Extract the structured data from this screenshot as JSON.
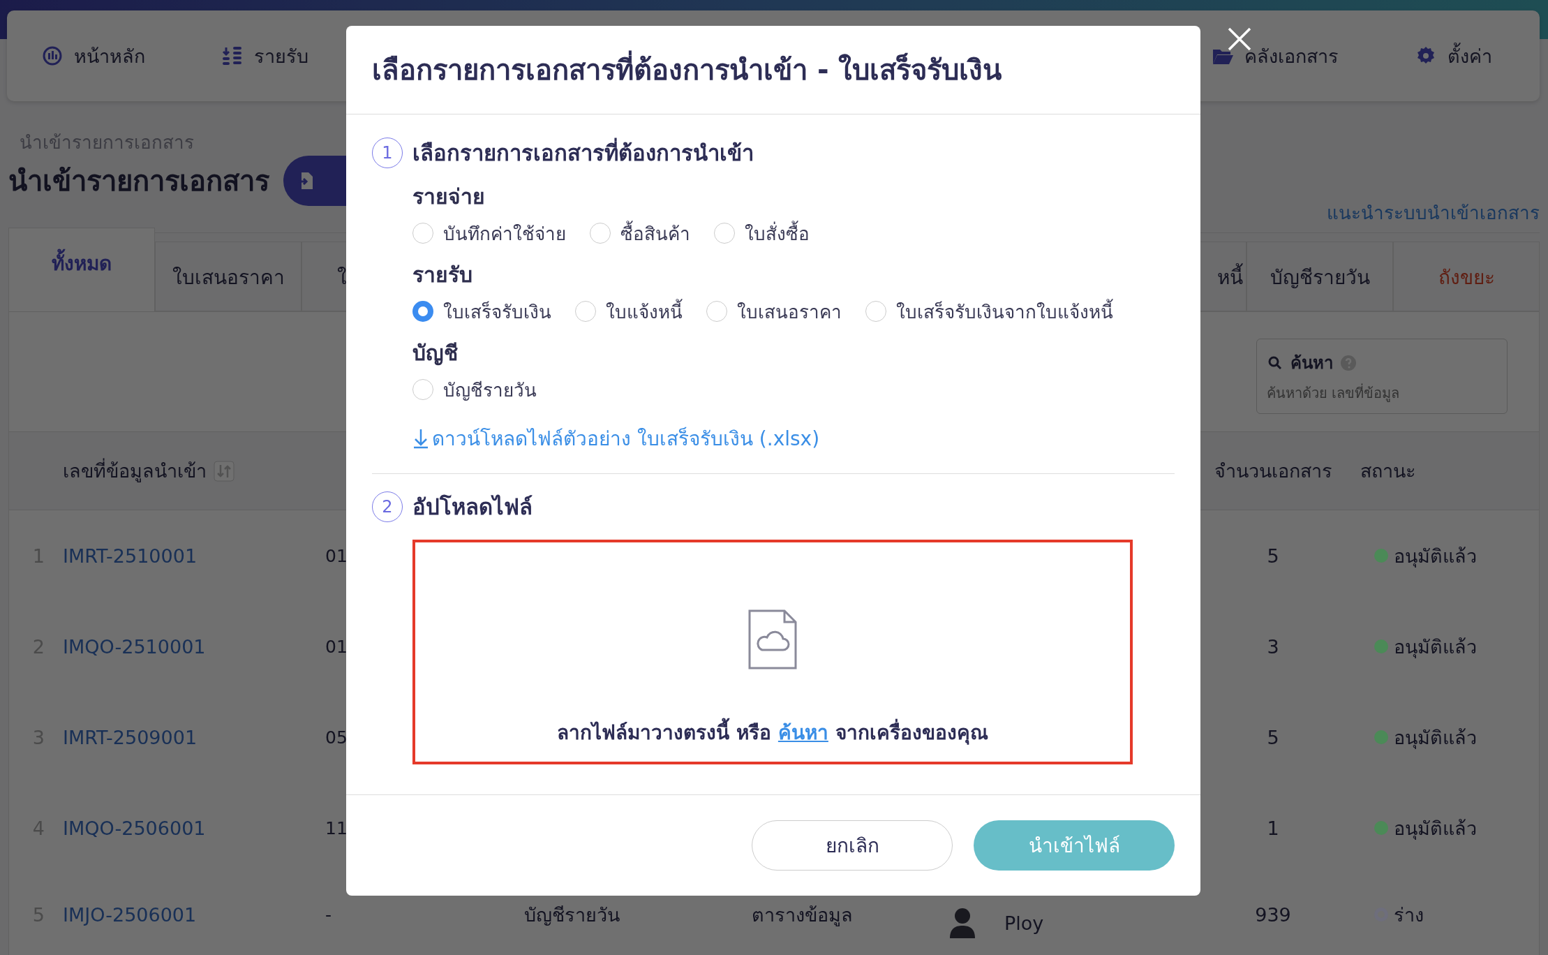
{
  "nav": {
    "items": [
      {
        "label": "หน้าหลัก",
        "kind": "dashboard"
      },
      {
        "label": "รายรับ",
        "kind": "income"
      },
      {
        "label": "คลังเอกสาร",
        "kind": "folder"
      },
      {
        "label": "ตั้งค่า",
        "kind": "settings"
      }
    ]
  },
  "page": {
    "breadcrumb": "นำเข้ารายการเอกสาร",
    "title": "นำเข้ารายการเอกสาร",
    "guide_link": "แนะนำระบบนำเข้าเอกสาร"
  },
  "tabs": {
    "left": [
      {
        "label": "ทั้งหมด",
        "selected": true,
        "kind": "normal"
      },
      {
        "label": "ใบเสนอราคา",
        "selected": false,
        "kind": "normal"
      },
      {
        "label": "ใ",
        "selected": false,
        "kind": "normal"
      }
    ],
    "right": [
      {
        "label": "หนี้",
        "selected": false,
        "kind": "normal"
      },
      {
        "label": "บัญชีรายวัน",
        "selected": false,
        "kind": "normal"
      },
      {
        "label": "ถังขยะ",
        "selected": false,
        "kind": "trash"
      }
    ]
  },
  "search": {
    "label": "ค้นหา",
    "placeholder": "ค้นหาด้วย เลขที่ข้อมูล"
  },
  "table": {
    "columns": {
      "id": "เลขที่ข้อมูลนำเข้า",
      "count": "จำนวนเอกสาร",
      "status": "สถานะ"
    },
    "rows": [
      {
        "no": "1",
        "id": "IMRT-2510001",
        "column_2": "01",
        "count": "5",
        "status": "อนุมัติแล้ว",
        "kind": "approved",
        "color": "#4b8a57"
      },
      {
        "no": "2",
        "id": "IMQO-2510001",
        "column_2": "01",
        "count": "3",
        "status": "อนุมัติแล้ว",
        "kind": "approved",
        "color": "#4b8a57"
      },
      {
        "no": "3",
        "id": "IMRT-2509001",
        "column_2": "05",
        "count": "5",
        "status": "อนุมัติแล้ว",
        "kind": "approved",
        "color": "#4b8a57"
      },
      {
        "no": "4",
        "id": "IMQO-2506001",
        "column_2": "11",
        "count": "1",
        "status": "อนุมัติแล้ว",
        "kind": "approved",
        "color": "#4b8a57"
      },
      {
        "no": "5",
        "id": "IMJO-2506001",
        "column_2": "-",
        "column_3": "บัญชีรายวัน",
        "column_4": "ตารางข้อมูล",
        "user": "Ploy",
        "count": "939",
        "status": "ร่าง",
        "kind": "draft",
        "color": "#6e6e7c"
      }
    ]
  },
  "modal": {
    "title": "เลือกรายการเอกสารที่ต้องการนำเข้า - ใบเสร็จรับเงิน",
    "step1": {
      "number": "1",
      "heading": "เลือกรายการเอกสารที่ต้องการนำเข้า",
      "groups": [
        {
          "label": "รายจ่าย",
          "options": [
            {
              "label": "บันทึกค่าใช้จ่าย",
              "selected": false
            },
            {
              "label": "ซื้อสินค้า",
              "selected": false
            },
            {
              "label": "ใบสั่งซื้อ",
              "selected": false
            }
          ]
        },
        {
          "label": "รายรับ",
          "options": [
            {
              "label": "ใบเสร็จรับเงิน",
              "selected": true
            },
            {
              "label": "ใบแจ้งหนี้",
              "selected": false
            },
            {
              "label": "ใบเสนอราคา",
              "selected": false
            },
            {
              "label": "ใบเสร็จรับเงินจากใบแจ้งหนี้",
              "selected": false
            }
          ]
        },
        {
          "label": "บัญชี",
          "options": [
            {
              "label": "บัญชีรายวัน",
              "selected": false
            }
          ]
        }
      ],
      "download_link": "ดาวน์โหลดไฟล์ตัวอย่าง ใบเสร็จรับเงิน (.xlsx)"
    },
    "step2": {
      "number": "2",
      "heading": "อัปโหลดไฟล์",
      "drop_text_before": "ลากไฟล์มาวางตรงนี้ หรือ",
      "drop_link": "ค้นหา",
      "drop_text_after": "จากเครื่องของคุณ"
    },
    "buttons": {
      "cancel": "ยกเลิก",
      "submit": "นำเข้าไฟล์"
    }
  }
}
